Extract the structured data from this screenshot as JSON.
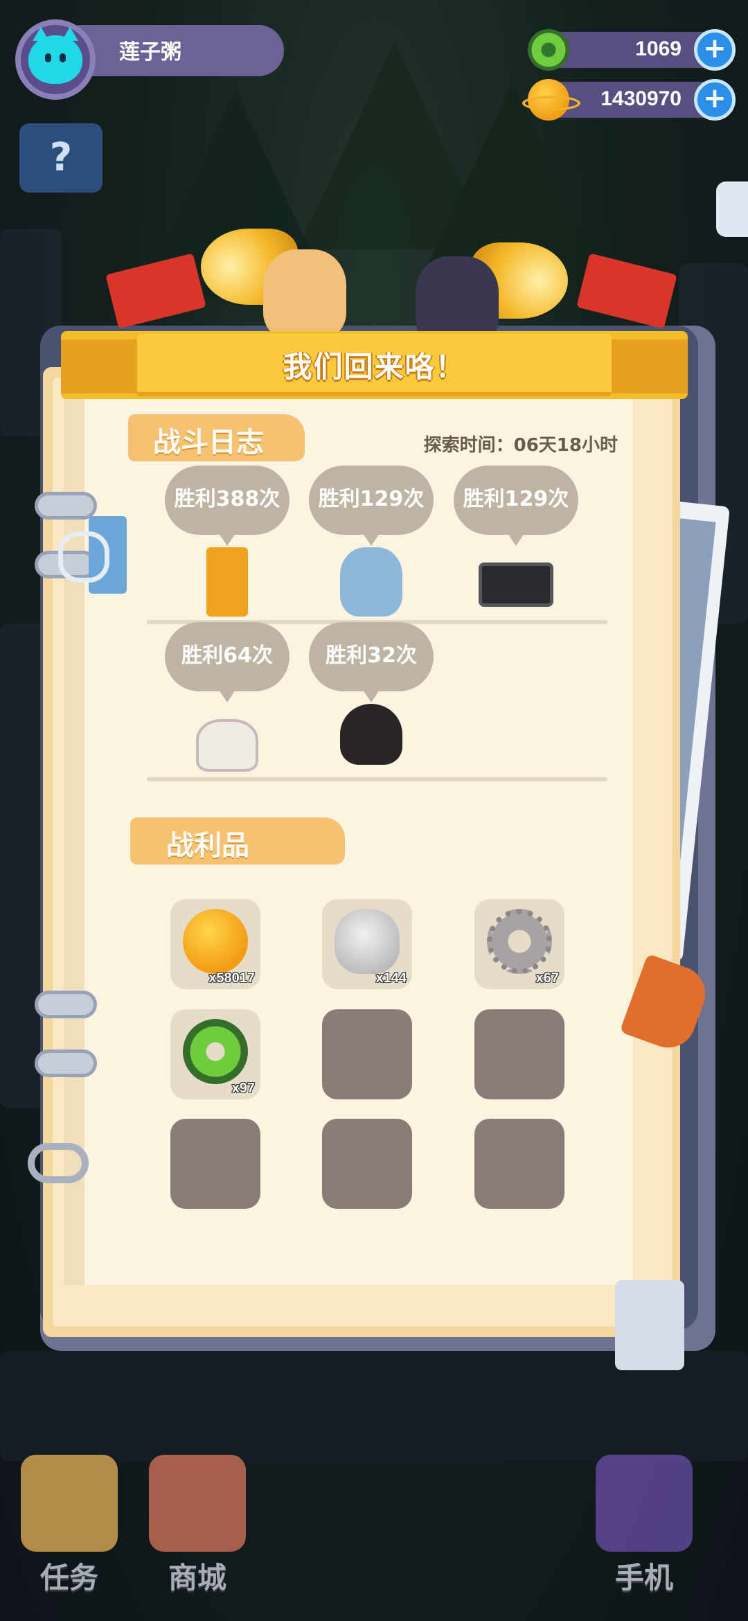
{
  "player": {
    "name": "莲子粥"
  },
  "currencies": [
    {
      "icon": "green-donut-icon",
      "value": "1069"
    },
    {
      "icon": "planet-coin-icon",
      "value": "1430970"
    }
  ],
  "popup": {
    "title": "我们回来咯！",
    "battle_log": {
      "heading": "战斗日志",
      "explore_time": "探索时间：06天18小时",
      "entries": [
        {
          "label": "胜利388次",
          "monster": "talisman-monster"
        },
        {
          "label": "胜利129次",
          "monster": "zombie-hand-monster"
        },
        {
          "label": "胜利129次",
          "monster": "cassette-tape-monster"
        },
        {
          "label": "胜利64次",
          "monster": "telephone-monster"
        },
        {
          "label": "胜利32次",
          "monster": "shadow-ghost-monster"
        }
      ]
    },
    "loot": {
      "heading": "战利品",
      "items": [
        {
          "icon": "planet-coin-icon",
          "count": "x58017"
        },
        {
          "icon": "white-stone-icon",
          "count": "x144"
        },
        {
          "icon": "gear-icon",
          "count": "x67"
        },
        {
          "icon": "green-donut-icon",
          "count": "x97"
        }
      ],
      "empty_slots": 5
    }
  },
  "bottom_nav": [
    {
      "label": "任务",
      "icon": "task-book-icon"
    },
    {
      "label": "商城",
      "icon": "shop-icon"
    },
    {
      "label": "手机",
      "icon": "phone-icon"
    }
  ]
}
